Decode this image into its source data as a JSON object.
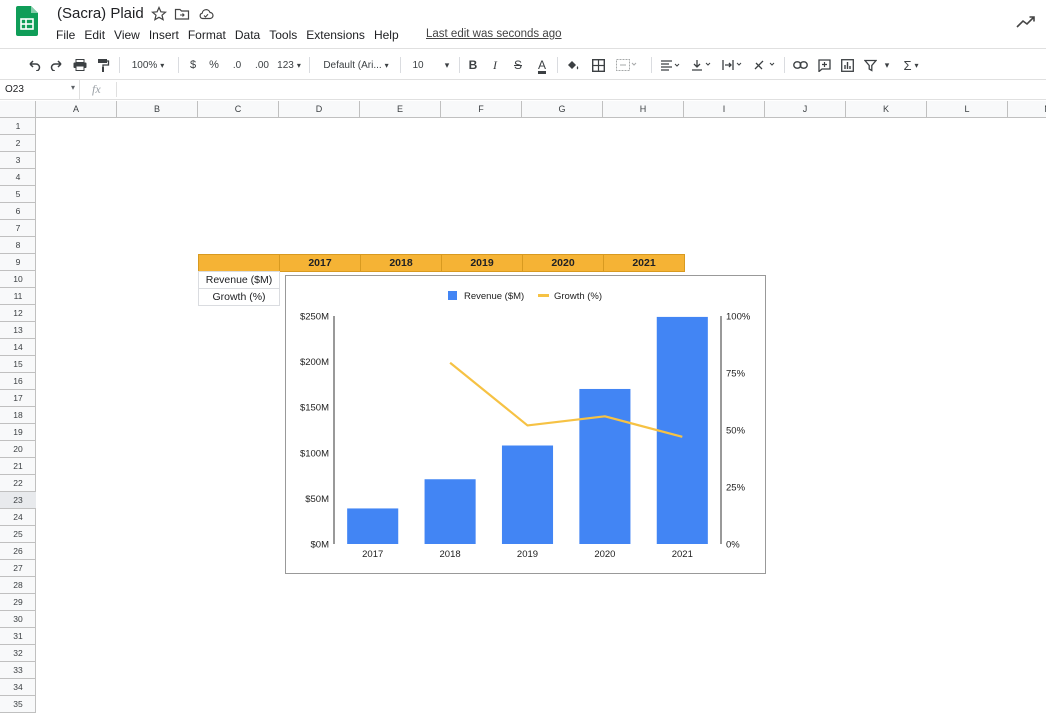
{
  "app": {
    "doc_title": "(Sacra) Plaid",
    "menu": [
      "File",
      "Edit",
      "View",
      "Insert",
      "Format",
      "Data",
      "Tools",
      "Extensions",
      "Help"
    ],
    "last_edit": "Last edit was seconds ago",
    "brand_color": "#0f9d58"
  },
  "toolbar": {
    "zoom": "100%",
    "currency": "$",
    "percent": "%",
    "dec_decrease": ".0",
    "dec_increase": ".00",
    "more_formats": "123",
    "font": "Default (Ari...",
    "font_size": "10",
    "bold": "B",
    "italic": "I",
    "strike": "S",
    "text_color": "A",
    "sum": "Σ"
  },
  "formula_bar": {
    "cell_ref": "O23",
    "fx": "fx",
    "value": ""
  },
  "grid": {
    "columns": [
      "A",
      "B",
      "C",
      "D",
      "E",
      "F",
      "G",
      "H",
      "I",
      "J",
      "K",
      "L",
      "M"
    ],
    "rows": [
      "1",
      "2",
      "3",
      "4",
      "5",
      "6",
      "7",
      "8",
      "9",
      "10",
      "11",
      "12",
      "13",
      "14",
      "15",
      "16",
      "17",
      "18",
      "19",
      "20",
      "21",
      "22",
      "23",
      "24",
      "25",
      "26",
      "27",
      "28",
      "29",
      "30",
      "31",
      "32",
      "33",
      "34",
      "35"
    ],
    "selected_row": "23"
  },
  "table": {
    "header": [
      "2017",
      "2018",
      "2019",
      "2020",
      "2021"
    ],
    "row_labels": [
      "Revenue ($M)",
      "Growth (%)"
    ],
    "header_color": "#f5b335"
  },
  "chart_data": {
    "type": "bar",
    "categories": [
      "2017",
      "2018",
      "2019",
      "2020",
      "2021"
    ],
    "series": [
      {
        "name": "Revenue ($M)",
        "type": "bar",
        "axis": "left",
        "color": "#4285f4",
        "values": [
          39,
          71,
          108,
          170,
          249
        ]
      },
      {
        "name": "Growth (%)",
        "type": "line",
        "axis": "right",
        "color": "#f6c244",
        "values": [
          null,
          79.5,
          52,
          56,
          47
        ]
      }
    ],
    "y_left": {
      "ticks": [
        "$0M",
        "$50M",
        "$100M",
        "$150M",
        "$200M",
        "$250M"
      ],
      "range": [
        0,
        250
      ]
    },
    "y_right": {
      "ticks": [
        "0%",
        "25%",
        "50%",
        "75%",
        "100%"
      ],
      "range": [
        0,
        100
      ]
    },
    "legend_position": "top",
    "grid": false
  }
}
